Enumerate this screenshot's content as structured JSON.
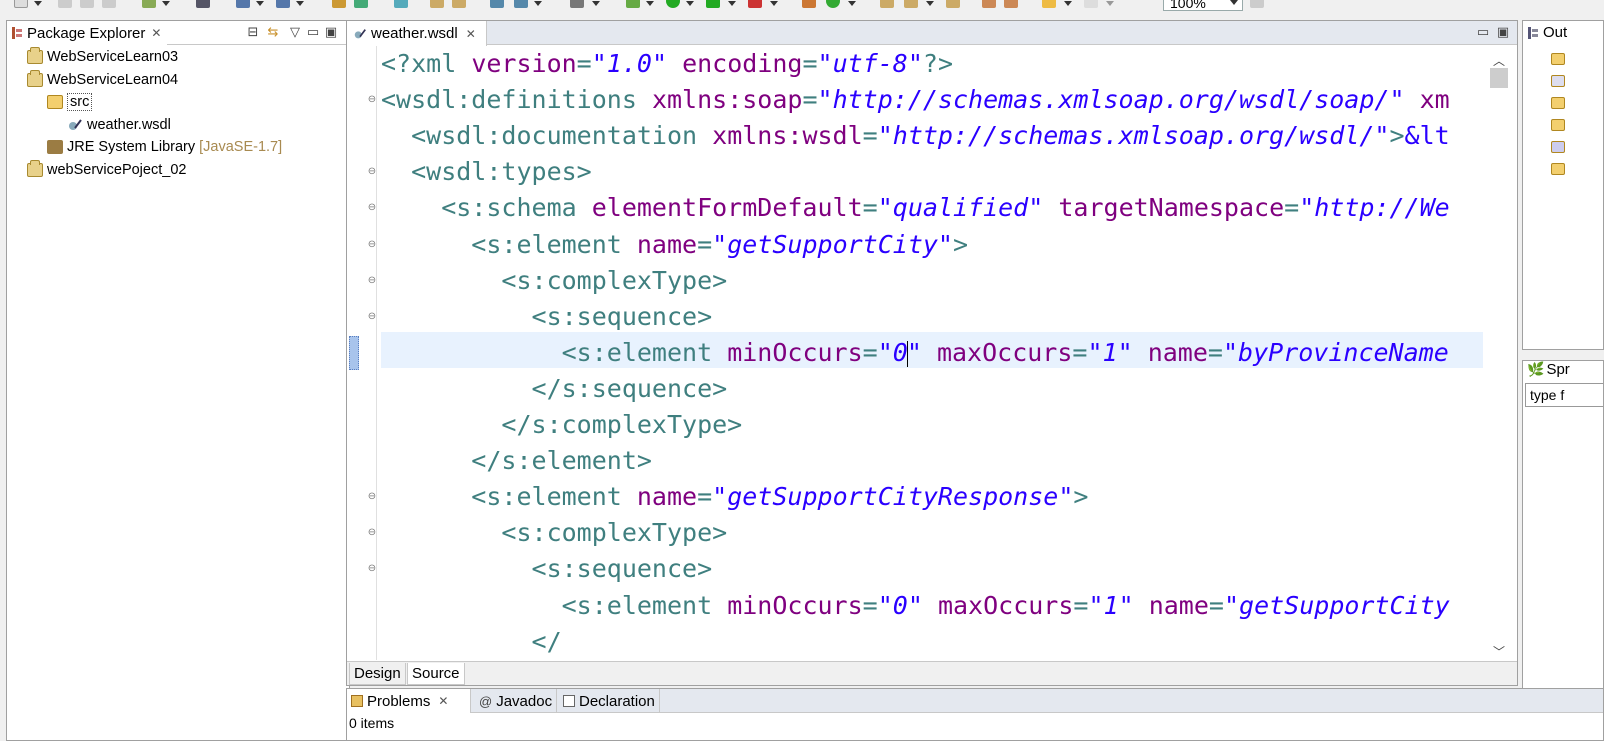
{
  "toolbar": {
    "zoom": "100%"
  },
  "package_explorer": {
    "title": "Package Explorer",
    "items": [
      {
        "label": "WebServiceLearn03"
      },
      {
        "label": "WebServiceLearn04"
      },
      {
        "label": "src"
      },
      {
        "label": "weather.wsdl"
      },
      {
        "label": "JRE System Library",
        "decoration": "[JavaSE-1.7]"
      },
      {
        "label": "webServicePoject_02"
      }
    ]
  },
  "editor": {
    "tab_label": "weather.wsdl",
    "lines": [
      [
        [
          "pi",
          "<?xml "
        ],
        [
          "attr",
          "version"
        ],
        [
          "pi",
          "="
        ],
        [
          "val",
          "\"1.0\""
        ],
        [
          "pi",
          " "
        ],
        [
          "attr",
          "encoding"
        ],
        [
          "pi",
          "="
        ],
        [
          "val",
          "\"utf-8\""
        ],
        [
          "pi",
          "?>"
        ]
      ],
      [
        [
          "tag",
          "<wsdl:definitions "
        ],
        [
          "attr",
          "xmlns:soap"
        ],
        [
          "tag",
          "="
        ],
        [
          "val",
          "\"http://schemas.xmlsoap.org/wsdl/soap/\""
        ],
        [
          "tag",
          " "
        ],
        [
          "attr",
          "xm"
        ]
      ],
      [
        [
          "tag",
          "  <wsdl:documentation "
        ],
        [
          "attr",
          "xmlns:wsdl"
        ],
        [
          "tag",
          "="
        ],
        [
          "val",
          "\"http://schemas.xmlsoap.org/wsdl/\""
        ],
        [
          "tag",
          ">"
        ],
        [
          "ent",
          "&lt"
        ]
      ],
      [
        [
          "tag",
          "  <wsdl:types>"
        ]
      ],
      [
        [
          "tag",
          "    <s:schema "
        ],
        [
          "attr",
          "elementFormDefault"
        ],
        [
          "tag",
          "="
        ],
        [
          "val",
          "\"qualified\""
        ],
        [
          "tag",
          " "
        ],
        [
          "attr",
          "targetNamespace"
        ],
        [
          "tag",
          "="
        ],
        [
          "val",
          "\"http://We"
        ]
      ],
      [
        [
          "tag",
          "      <s:element "
        ],
        [
          "attr",
          "name"
        ],
        [
          "tag",
          "="
        ],
        [
          "val",
          "\"getSupportCity\""
        ],
        [
          "tag",
          ">"
        ]
      ],
      [
        [
          "tag",
          "        <s:complexType>"
        ]
      ],
      [
        [
          "tag",
          "          <s:sequence>"
        ]
      ],
      [
        [
          "tag",
          "            <s:element "
        ],
        [
          "attr",
          "minOccurs"
        ],
        [
          "tag",
          "="
        ],
        [
          "val",
          "\"0"
        ],
        [
          "caret",
          ""
        ],
        [
          "val",
          "\""
        ],
        [
          "tag",
          " "
        ],
        [
          "attr",
          "maxOccurs"
        ],
        [
          "tag",
          "="
        ],
        [
          "val",
          "\"1\""
        ],
        [
          "tag",
          " "
        ],
        [
          "attr",
          "name"
        ],
        [
          "tag",
          "="
        ],
        [
          "val",
          "\"byProvinceName"
        ]
      ],
      [
        [
          "tag",
          "          </s:sequence>"
        ]
      ],
      [
        [
          "tag",
          "        </s:complexType>"
        ]
      ],
      [
        [
          "tag",
          "      </s:element>"
        ]
      ],
      [
        [
          "tag",
          "      <s:element "
        ],
        [
          "attr",
          "name"
        ],
        [
          "tag",
          "="
        ],
        [
          "val",
          "\"getSupportCityResponse\""
        ],
        [
          "tag",
          ">"
        ]
      ],
      [
        [
          "tag",
          "        <s:complexType>"
        ]
      ],
      [
        [
          "tag",
          "          <s:sequence>"
        ]
      ],
      [
        [
          "tag",
          "            <s:element "
        ],
        [
          "attr",
          "minOccurs"
        ],
        [
          "tag",
          "="
        ],
        [
          "val",
          "\"0\""
        ],
        [
          "tag",
          " "
        ],
        [
          "attr",
          "maxOccurs"
        ],
        [
          "tag",
          "="
        ],
        [
          "val",
          "\"1\""
        ],
        [
          "tag",
          " "
        ],
        [
          "attr",
          "name"
        ],
        [
          "tag",
          "="
        ],
        [
          "val",
          "\"getSupportCity"
        ]
      ],
      [
        [
          "tag",
          "          </"
        ]
      ]
    ],
    "bottom_tabs": {
      "design": "Design",
      "source": "Source"
    }
  },
  "outline": {
    "title": "Out"
  },
  "spring": {
    "title": "Spr",
    "filter_placeholder": "type f"
  },
  "bottom_panel": {
    "tabs": [
      {
        "label": "Problems"
      },
      {
        "label": "Javadoc"
      },
      {
        "label": "Declaration"
      }
    ],
    "status": "0 items"
  },
  "colors": {
    "tag": "#3f7f7f",
    "attribute": "#7f007f",
    "value": "#2a00ff",
    "current_line": "#e8f2fe"
  }
}
